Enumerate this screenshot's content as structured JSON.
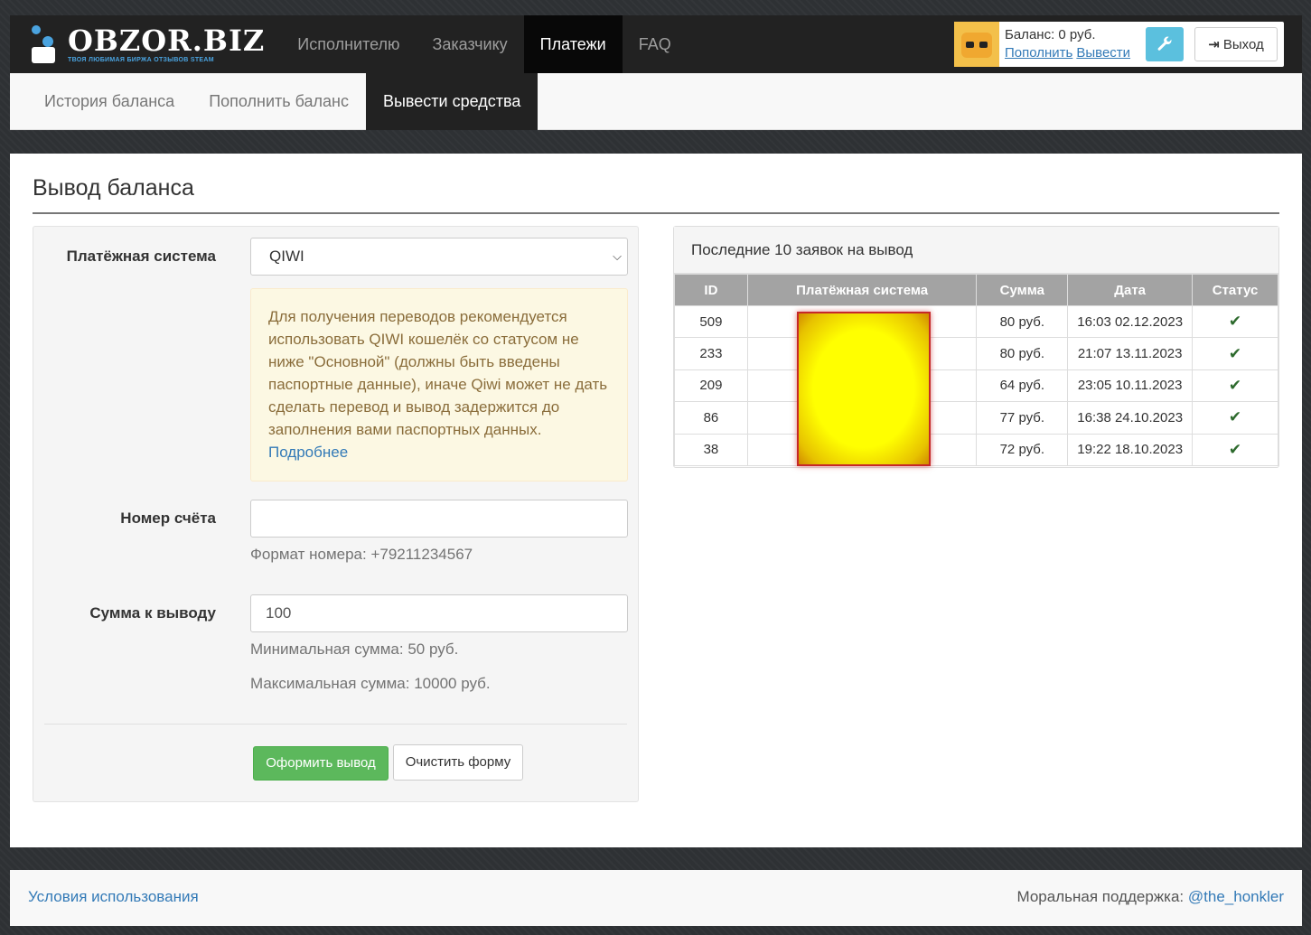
{
  "brand": {
    "title": "OBZOR.BIZ",
    "tagline": "ТВОЯ ЛЮБИМАЯ БИРЖА ОТЗЫВОВ STEAM",
    "accent": "#4aa3df"
  },
  "nav": {
    "items": [
      {
        "label": "Исполнителю"
      },
      {
        "label": "Заказчику"
      },
      {
        "label": "Платежи",
        "active": true
      },
      {
        "label": "FAQ"
      }
    ]
  },
  "user": {
    "balance_text": "Баланс: 0 руб.",
    "topup_link": "Пополнить",
    "withdraw_link": "Вывести",
    "settings_icon": "wrench-icon",
    "logout_label": "Выход"
  },
  "subnav": {
    "items": [
      {
        "label": "История баланса"
      },
      {
        "label": "Пополнить баланс"
      },
      {
        "label": "Вывести средства",
        "active": true
      }
    ]
  },
  "page": {
    "title": "Вывод баланса"
  },
  "form": {
    "payment_label": "Платёжная система",
    "payment_value": "QIWI",
    "alert_text": "Для получения переводов рекомендуется использовать QIWI кошелёк со статусом не ниже \"Основной\" (должны быть введены паспортные данные), иначе Qiwi может не дать сделать перевод и вывод задержится до заполнения вами паспортных данных.",
    "alert_link": "Подробнее",
    "account_label": "Номер счёта",
    "account_value": "",
    "account_help": "Формат номера: +79211234567",
    "amount_label": "Сумма к выводу",
    "amount_value": "100",
    "min_help": "Минимальная сумма: 50 руб.",
    "max_help": "Максимальная сумма: 10000 руб.",
    "submit_label": "Оформить вывод",
    "clear_label": "Очистить форму"
  },
  "requests": {
    "heading": "Последние 10 заявок на вывод",
    "columns": [
      "ID",
      "Платёжная система",
      "Сумма",
      "Дата",
      "Статус"
    ],
    "rows": [
      {
        "id": "509",
        "system": "",
        "sum": "80 руб.",
        "date": "16:03 02.12.2023",
        "status": "check-icon"
      },
      {
        "id": "233",
        "system": "",
        "sum": "80 руб.",
        "date": "21:07 13.11.2023",
        "status": "check-icon"
      },
      {
        "id": "209",
        "system": "",
        "sum": "64 руб.",
        "date": "23:05 10.11.2023",
        "status": "check-icon"
      },
      {
        "id": "86",
        "system": "",
        "sum": "77 руб.",
        "date": "16:38 24.10.2023",
        "status": "check-icon"
      },
      {
        "id": "38",
        "system": "",
        "sum": "72 руб.",
        "date": "19:22 18.10.2023",
        "status": "check-icon"
      }
    ]
  },
  "footer": {
    "terms_link": "Условия использования",
    "support_text": "Моральная поддержка:",
    "support_link": "@the_honkler"
  }
}
